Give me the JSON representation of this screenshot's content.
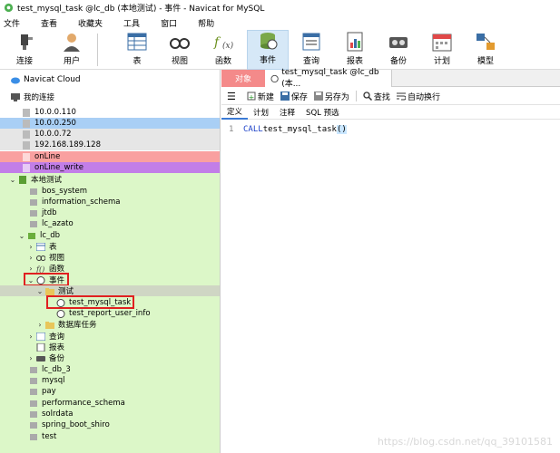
{
  "window": {
    "title": "test_mysql_task @lc_db (本地测试) - 事件 - Navicat for MySQL"
  },
  "menu": [
    "文件",
    "查看",
    "收藏夹",
    "工具",
    "窗口",
    "帮助"
  ],
  "toolbar": [
    {
      "label": "连接",
      "icon": "plug-icon"
    },
    {
      "label": "用户",
      "icon": "user-icon"
    },
    {
      "label": "表",
      "icon": "table-icon"
    },
    {
      "label": "视图",
      "icon": "glasses-icon"
    },
    {
      "label": "函数",
      "icon": "function-icon"
    },
    {
      "label": "事件",
      "icon": "event-icon"
    },
    {
      "label": "查询",
      "icon": "query-icon"
    },
    {
      "label": "报表",
      "icon": "report-icon"
    },
    {
      "label": "备份",
      "icon": "backup-icon"
    },
    {
      "label": "计划",
      "icon": "calendar-icon"
    },
    {
      "label": "模型",
      "icon": "model-icon"
    }
  ],
  "tree": {
    "cloud": "Navicat Cloud",
    "my_connections": "我的连接",
    "items": [
      {
        "label": "10.0.0.110"
      },
      {
        "label": "10.0.0.250"
      },
      {
        "label": "10.0.0.72"
      },
      {
        "label": "192.168.189.128"
      },
      {
        "label": "onLine"
      },
      {
        "label": "onLine_write"
      },
      {
        "label": "本地测试"
      },
      {
        "label": "bos_system"
      },
      {
        "label": "information_schema"
      },
      {
        "label": "jtdb"
      },
      {
        "label": "lc_azato"
      },
      {
        "label": "lc_db"
      },
      {
        "label": "表"
      },
      {
        "label": "视图"
      },
      {
        "label": "函数"
      },
      {
        "label": "事件"
      },
      {
        "label": "测试"
      },
      {
        "label": "test_mysql_task"
      },
      {
        "label": "test_report_user_info"
      },
      {
        "label": "数据库任务"
      },
      {
        "label": "查询"
      },
      {
        "label": "报表"
      },
      {
        "label": "备份"
      },
      {
        "label": "lc_db_3"
      },
      {
        "label": "mysql"
      },
      {
        "label": "pay"
      },
      {
        "label": "performance_schema"
      },
      {
        "label": "solrdata"
      },
      {
        "label": "spring_boot_shiro"
      },
      {
        "label": "test"
      }
    ]
  },
  "tabs": {
    "objects": "对象",
    "current": "test_mysql_task @lc_db (本..."
  },
  "subtoolbar": {
    "menu_icon": "☰",
    "new": "新建",
    "save": "保存",
    "save_as": "另存为",
    "find": "查找",
    "autowrap": "自动换行"
  },
  "editor_tabs": [
    "定义",
    "计划",
    "注释",
    "SQL 预选"
  ],
  "editor": {
    "line": "1",
    "keyword": "CALL",
    "call": " test_mysql_task",
    "parens": "()"
  },
  "watermark": "https://blog.csdn.net/qq_39101581",
  "colors": {
    "onLine": "#f9a0a0",
    "onLine_write": "#c27ee8",
    "local": "#dcf7c8",
    "selected": "#a9cff5",
    "gray": "#e6e6e6"
  }
}
